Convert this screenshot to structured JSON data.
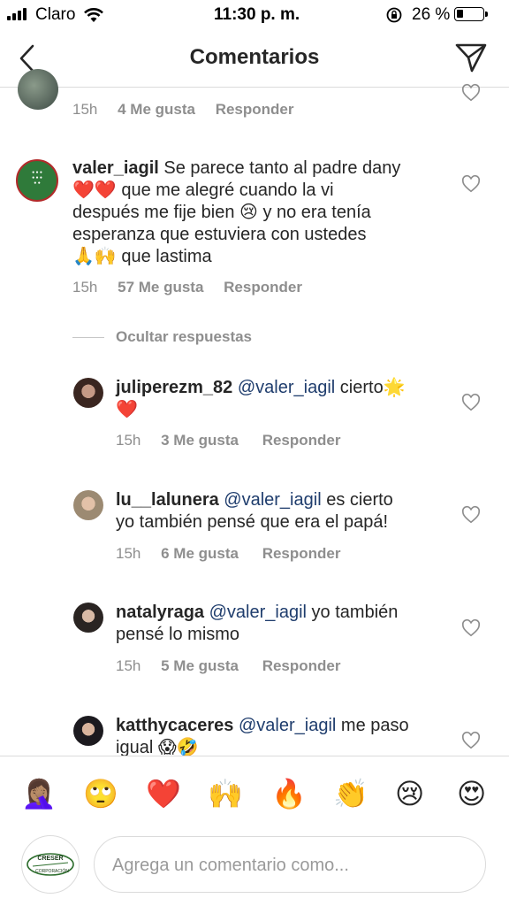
{
  "status": {
    "carrier": "Claro",
    "time": "11:30 p. m.",
    "battery_pct": "26 %",
    "battery_level": 0.26
  },
  "header": {
    "title": "Comentarios"
  },
  "top_comment": {
    "time": "15h",
    "likes": "4 Me gusta",
    "reply": "Responder"
  },
  "main_comment": {
    "username": "valer_iagil",
    "line1": "Se parece tanto al padre dany",
    "line2_emoji": "❤️❤️",
    "line2": "que me alegré cuando la vi",
    "line3": "después me fije bien",
    "line3_emoji": "😢",
    "line3b": "y no era tenía",
    "line4": "esperanza  que estuviera con ustedes",
    "line5_emoji": "🙏🙌",
    "line5": "que lastima",
    "time": "15h",
    "likes": "57 Me gusta",
    "reply": "Responder",
    "hide_replies": "Ocultar respuestas"
  },
  "replies": [
    {
      "username": "juliperezm_82",
      "mention": "@valer_iagil",
      "text": "cierto",
      "emoji_inline": "🌟",
      "emoji_line2": "❤️",
      "time": "15h",
      "likes": "3 Me gusta",
      "reply": "Responder"
    },
    {
      "username": "lu__lalunera",
      "mention": "@valer_iagil",
      "text": "es cierto",
      "line2": "yo también pensé que era el papá!",
      "time": "15h",
      "likes": "6 Me gusta",
      "reply": "Responder"
    },
    {
      "username": "natalyraga",
      "mention": "@valer_iagil",
      "text": "yo también",
      "line2": "pensé lo mismo",
      "time": "15h",
      "likes": "5 Me gusta",
      "reply": "Responder"
    },
    {
      "username": "katthycaceres",
      "mention": "@valer_iagil",
      "text": "me paso",
      "line2": "igual",
      "emoji_line2": "😱🤣"
    }
  ],
  "emoji_bar": [
    "🤦🏽‍♀️",
    "🙄",
    "❤️",
    "🙌",
    "🔥",
    "👏",
    "😢",
    "😍"
  ],
  "composer": {
    "placeholder": "Agrega un comentario como...",
    "avatar_text_top": "CRESER",
    "avatar_text_bottom": "CORPORACIÓN"
  },
  "colors": {
    "mention": "#1f3d6d",
    "meta": "#8e8e8e",
    "divider": "#dbdbdb"
  }
}
